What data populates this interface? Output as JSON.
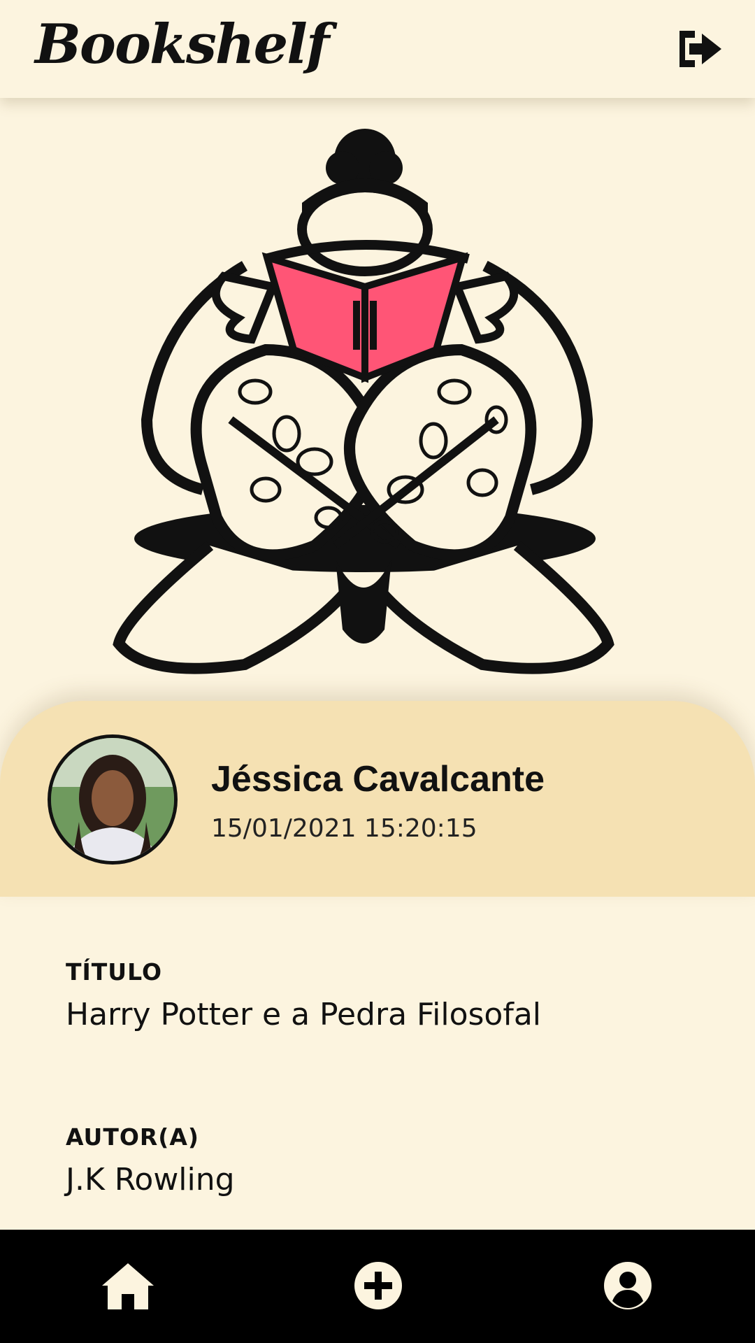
{
  "app": {
    "title": "Bookshelf"
  },
  "header": {
    "logout_icon": "sign-out-icon"
  },
  "hero": {
    "illustration": "person-reading-book",
    "book_color": "#ff5576"
  },
  "profile": {
    "name": "Jéssica Cavalcante",
    "timestamp": "15/01/2021 15:20:15"
  },
  "book": {
    "title_label": "TÍTULO",
    "title": "Harry Potter e a Pedra Filosofal",
    "author_label": "AUTOR(A)",
    "author": "J.K Rowling"
  },
  "nav": {
    "items": [
      {
        "icon": "home-icon"
      },
      {
        "icon": "add-circle-icon"
      },
      {
        "icon": "user-circle-icon"
      }
    ]
  },
  "colors": {
    "background": "#fcf4df",
    "profile_bg": "#f5e1b3",
    "nav_bg": "#000000",
    "accent": "#ff5576"
  }
}
